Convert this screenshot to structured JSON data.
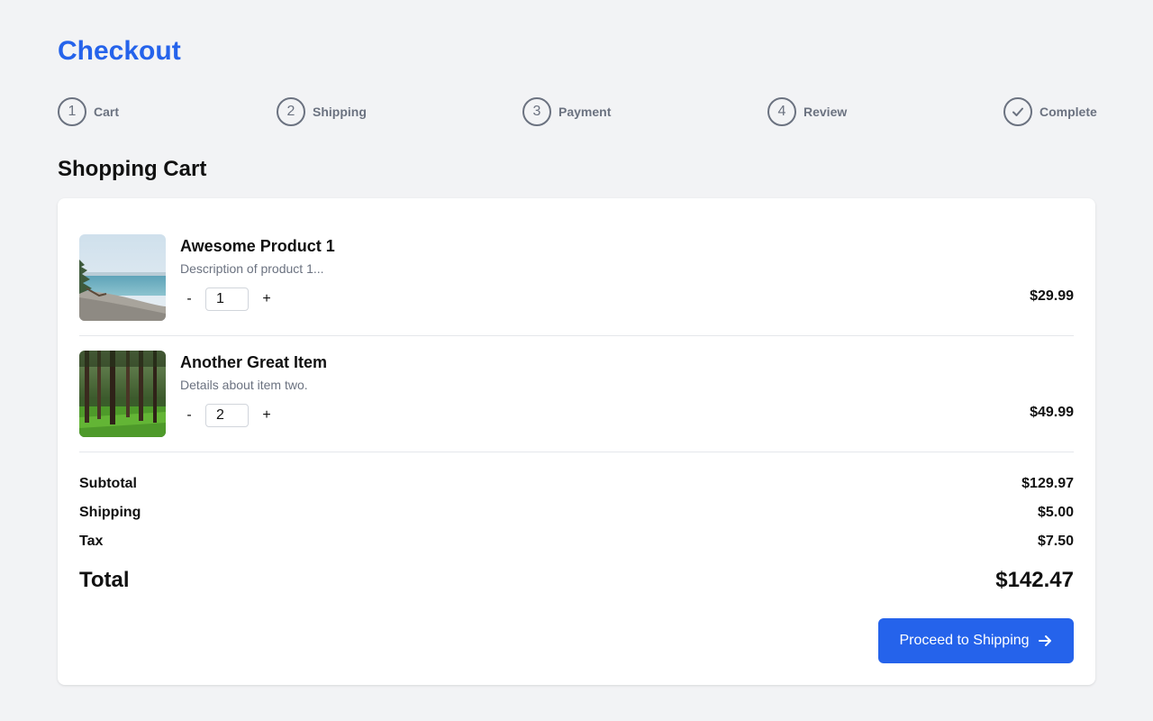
{
  "page": {
    "title": "Checkout"
  },
  "steps": [
    {
      "number": "1",
      "label": "Cart"
    },
    {
      "number": "2",
      "label": "Shipping"
    },
    {
      "number": "3",
      "label": "Payment"
    },
    {
      "number": "4",
      "label": "Review"
    },
    {
      "number": "",
      "label": "Complete",
      "icon": "check-icon"
    }
  ],
  "cart": {
    "title": "Shopping Cart",
    "items": [
      {
        "name": "Awesome Product 1",
        "description": "Description of product 1...",
        "quantity": "1",
        "price": "$29.99",
        "image": "beach-scene"
      },
      {
        "name": "Another Great Item",
        "description": "Details about item two.",
        "quantity": "2",
        "price": "$49.99",
        "image": "forest-scene"
      }
    ],
    "minus_label": "-",
    "plus_label": "+"
  },
  "summary": {
    "subtotal_label": "Subtotal",
    "subtotal": "$129.97",
    "shipping_label": "Shipping",
    "shipping": "$5.00",
    "tax_label": "Tax",
    "tax": "$7.50",
    "total_label": "Total",
    "total": "$142.47"
  },
  "actions": {
    "proceed_label": "Proceed to Shipping",
    "proceed_icon": "arrow-right-icon"
  },
  "colors": {
    "accent": "#2563eb",
    "muted": "#6b7280",
    "background": "#f2f3f5"
  }
}
